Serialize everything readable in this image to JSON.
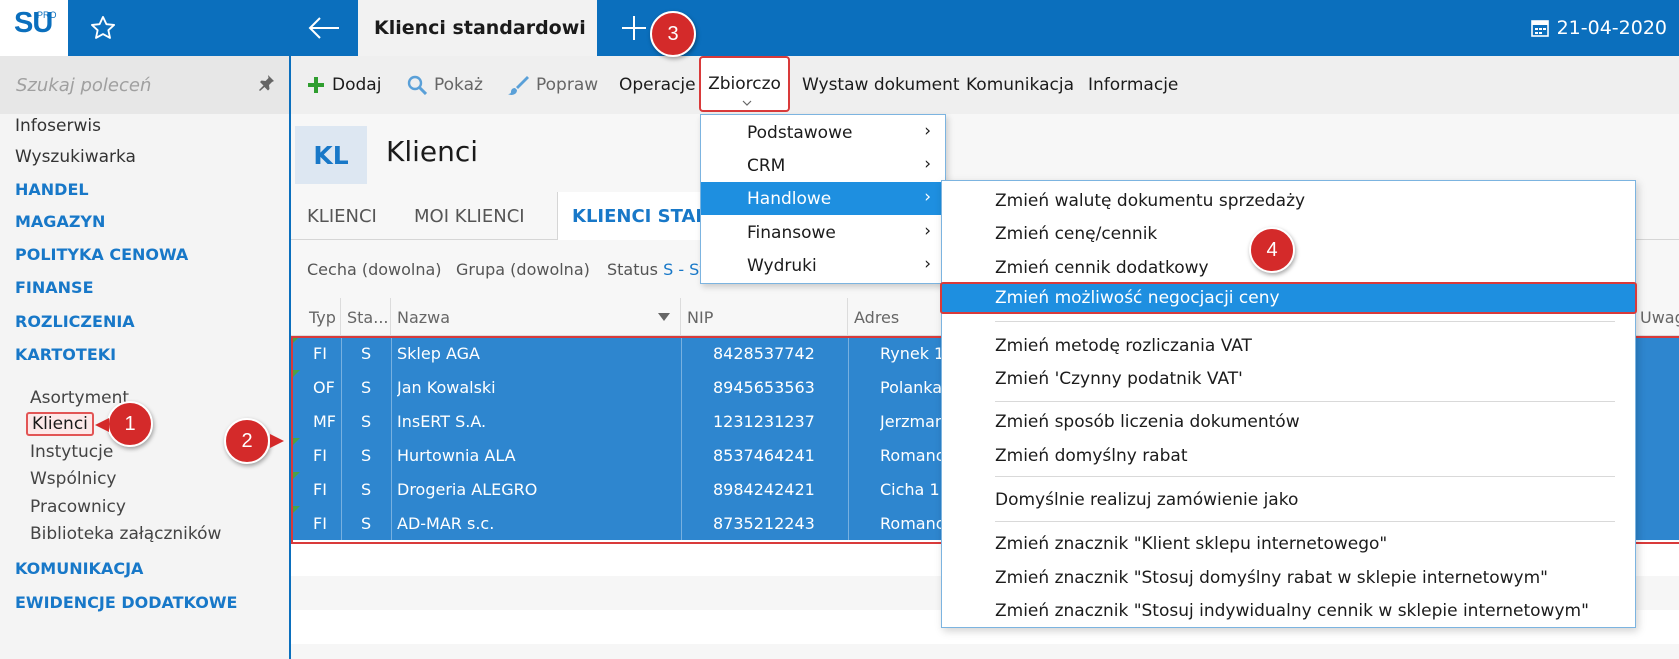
{
  "app": {
    "logo_text": "SU",
    "logo_badge": "PRO",
    "active_tab_title": "Klienci standardowi",
    "date": "21-04-2020"
  },
  "sidebar": {
    "search_placeholder": "Szukaj poleceń",
    "items": [
      {
        "label": "Infoserwis"
      },
      {
        "label": "Wyszukiwarka"
      }
    ],
    "sections": [
      {
        "label": "HANDEL"
      },
      {
        "label": "MAGAZYN"
      },
      {
        "label": "POLITYKA CENOWA"
      },
      {
        "label": "FINANSE"
      },
      {
        "label": "ROZLICZENIA"
      },
      {
        "label": "KARTOTEKI"
      }
    ],
    "kartoteki_items": [
      {
        "label": "Asortyment"
      },
      {
        "label": "Klienci"
      },
      {
        "label": "Instytucje"
      },
      {
        "label": "Wspólnicy"
      },
      {
        "label": "Pracownicy"
      },
      {
        "label": "Biblioteka załączników"
      }
    ],
    "bottom_sections": [
      {
        "label": "KOMUNIKACJA"
      },
      {
        "label": "EWIDENCJE DODATKOWE"
      }
    ]
  },
  "toolbar": {
    "add": "Dodaj",
    "show": "Pokaż",
    "edit": "Popraw",
    "operations": "Operacje",
    "bulk": "Zbiorczo",
    "issue_document": "Wystaw dokument",
    "communication": "Komunikacja",
    "information": "Informacje"
  },
  "module": {
    "badge": "KL",
    "title": "Klienci"
  },
  "tabs": [
    {
      "label": "KLIENCI"
    },
    {
      "label": "MOI KLIENCI"
    },
    {
      "label": "KLIENCI STAN"
    }
  ],
  "filters": {
    "feature": "Cecha (dowolna)",
    "group": "Grupa (dowolna)",
    "status_label": "Status",
    "status_value": "S - St"
  },
  "grid": {
    "columns": [
      "Typ",
      "Sta...",
      "Nazwa",
      "NIP",
      "Adres",
      "Uwag"
    ],
    "rows": [
      {
        "typ": "FI",
        "status": "S",
        "nazwa": "Sklep AGA",
        "nip": "8428537742",
        "adres": "Rynek 1"
      },
      {
        "typ": "OF",
        "status": "S",
        "nazwa": "Jan Kowalski",
        "nip": "8945653563",
        "adres": "Polanka"
      },
      {
        "typ": "MF",
        "status": "S",
        "nazwa": "InsERT S.A.",
        "nip": "1231231237",
        "adres": "Jerzman"
      },
      {
        "typ": "FI",
        "status": "S",
        "nazwa": "Hurtownia ALA",
        "nip": "8537464241",
        "adres": "Romano"
      },
      {
        "typ": "FI",
        "status": "S",
        "nazwa": "Drogeria ALEGRO",
        "nip": "8984242421",
        "adres": "Cicha  1"
      },
      {
        "typ": "FI",
        "status": "S",
        "nazwa": "AD-MAR s.c.",
        "nip": "8735212243",
        "adres": "Romano"
      }
    ]
  },
  "menu_level1": [
    {
      "label": "Podstawowe",
      "arrow": "›"
    },
    {
      "label": "CRM",
      "arrow": "›"
    },
    {
      "label": "Handlowe",
      "arrow": "›"
    },
    {
      "label": "Finansowe",
      "arrow": "›"
    },
    {
      "label": "Wydruki",
      "arrow": "›"
    }
  ],
  "menu_level2": [
    {
      "label": "Zmień walutę dokumentu sprzedaży"
    },
    {
      "label": "Zmień cenę/cennik"
    },
    {
      "label": "Zmień cennik dodatkowy"
    },
    {
      "label": "Zmień możliwość negocjacji ceny"
    },
    {
      "label": "Zmień metodę rozliczania VAT"
    },
    {
      "label": "Zmień 'Czynny podatnik VAT'"
    },
    {
      "label": "Zmień sposób liczenia dokumentów"
    },
    {
      "label": "Zmień domyślny rabat"
    },
    {
      "label": "Domyślnie realizuj zamówienie jako"
    },
    {
      "label": "Zmień znacznik \"Klient sklepu internetowego\""
    },
    {
      "label": "Zmień znacznik \"Stosuj domyślny rabat w sklepie internetowym\""
    },
    {
      "label": "Zmień znacznik \"Stosuj indywidualny cennik w sklepie internetowym\""
    }
  ],
  "callouts": [
    "1",
    "2",
    "3",
    "4"
  ],
  "colors": {
    "brand_blue": "#0b6fbd",
    "selection_blue": "#2e86cf",
    "menu_highlight": "#1e8fe0",
    "callout_red": "#d42a2a"
  }
}
